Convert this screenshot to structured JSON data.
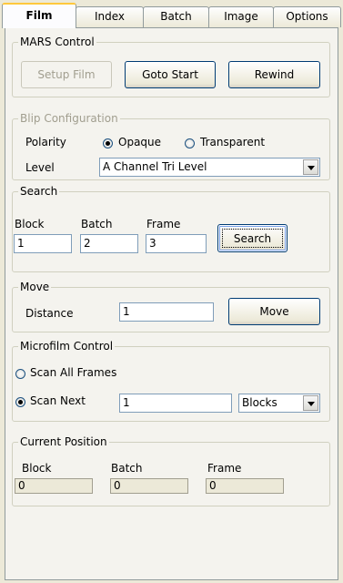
{
  "tabs": [
    {
      "label": "Film"
    },
    {
      "label": "Index"
    },
    {
      "label": "Batch"
    },
    {
      "label": "Image"
    },
    {
      "label": "Options"
    }
  ],
  "mars": {
    "legend": "MARS Control",
    "setup_label": "Setup Film",
    "goto_label": "Goto Start",
    "rewind_label": "Rewind"
  },
  "blip": {
    "legend": "Blip Configuration",
    "polarity_label": "Polarity",
    "opaque_label": "Opaque",
    "transparent_label": "Transparent",
    "level_label": "Level",
    "level_value": "A Channel Tri Level"
  },
  "search": {
    "legend": "Search",
    "block_label": "Block",
    "batch_label": "Batch",
    "frame_label": "Frame",
    "block_value": "1",
    "batch_value": "2",
    "frame_value": "3",
    "button_label": "Search"
  },
  "move": {
    "legend": "Move",
    "distance_label": "Distance",
    "distance_value": "1",
    "button_label": "Move"
  },
  "microfilm": {
    "legend": "Microfilm Control",
    "scan_all_label": "Scan All Frames",
    "scan_next_label": "Scan Next",
    "scan_next_value": "1",
    "unit_value": "Blocks"
  },
  "position": {
    "legend": "Current Position",
    "block_label": "Block",
    "batch_label": "Batch",
    "frame_label": "Frame",
    "block_value": "0",
    "batch_value": "0",
    "frame_value": "0"
  }
}
